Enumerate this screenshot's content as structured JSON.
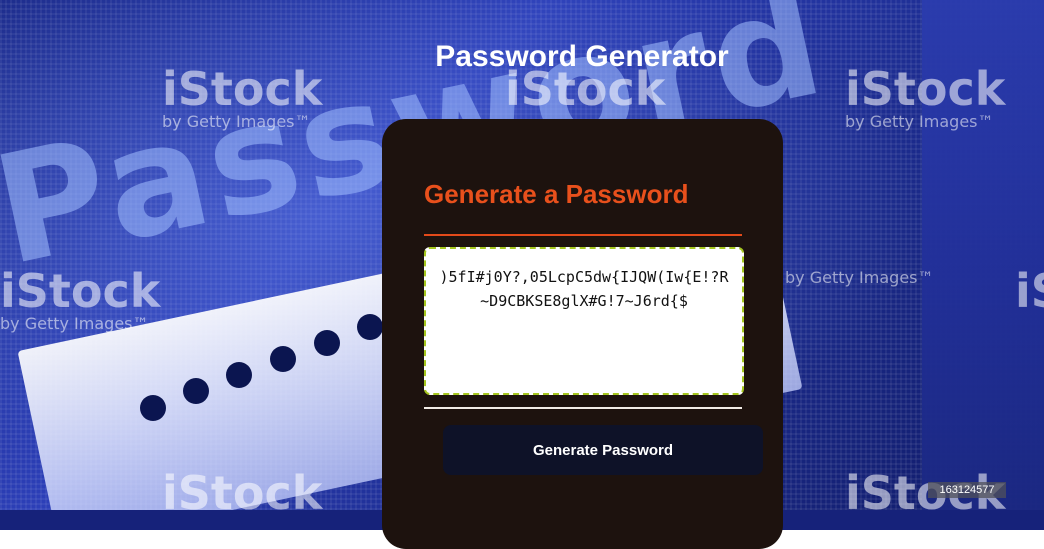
{
  "page": {
    "title": "Password Generator"
  },
  "card": {
    "heading": "Generate a Password",
    "password_value": ")5fI#j0Y?,05LcpC5dw{IJQW(Iw{E!?R~D9CBKSE8glX#G!7~J6rd{$",
    "generate_button_label": "Generate Password"
  },
  "background": {
    "image_word": "Password",
    "watermark_brand": "iStock",
    "watermark_tagline": "by Getty Images™",
    "stock_id": "163124577"
  },
  "colors": {
    "card_background": "#1d120e",
    "heading_accent": "#e8501c",
    "password_border": "#a5c61e",
    "button_background": "#0e1228",
    "page_background": "#2c3fb8"
  }
}
